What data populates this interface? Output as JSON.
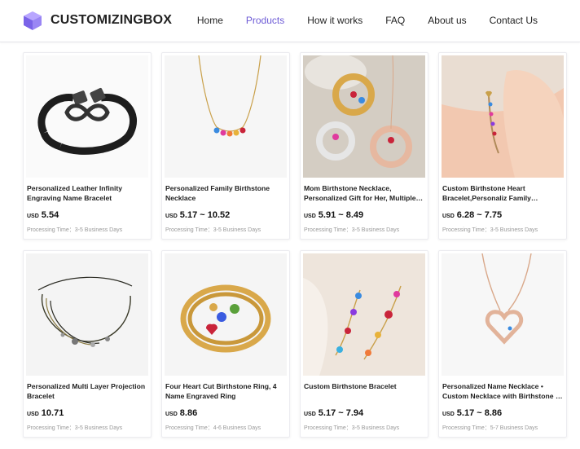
{
  "brand": {
    "name": "CUSTOMIZINGBOX",
    "logo_icon": "cube-logo-icon",
    "accent": "#6d5bd6"
  },
  "nav": [
    {
      "label": "Home",
      "active": false
    },
    {
      "label": "Products",
      "active": true
    },
    {
      "label": "How it works",
      "active": false
    },
    {
      "label": "FAQ",
      "active": false
    },
    {
      "label": "About us",
      "active": false
    },
    {
      "label": "Contact Us",
      "active": false
    }
  ],
  "products": [
    {
      "title": "Personalized Leather Infinity Engraving Name Bracelet",
      "currency": "USD",
      "price": "5.54",
      "processing": "Processing Time：3-5 Business Days",
      "image_icon": "leather-infinity-bracelet-image"
    },
    {
      "title": "Personalized Family Birthstone Necklace",
      "currency": "USD",
      "price": "5.17 ~ 10.52",
      "processing": "Processing Time：3-5 Business Days",
      "image_icon": "birthstone-necklace-image"
    },
    {
      "title": "Mom Birthstone Necklace, Personalized Gift for Her, Multiple Birthstone Necklace",
      "currency": "USD",
      "price": "5.91 ~ 8.49",
      "processing": "Processing Time：3-5 Business Days",
      "image_icon": "mom-circle-necklace-image"
    },
    {
      "title": "Custom Birthstone Heart Bracelet,Personaliz Family Birthstone Bracelet",
      "currency": "USD",
      "price": "6.28 ~ 7.75",
      "processing": "Processing Time：3-5 Business Days",
      "image_icon": "heart-bracelet-wrist-image"
    },
    {
      "title": "Personalized Multi Layer Projection Bracelet",
      "currency": "USD",
      "price": "10.71",
      "processing": "Processing Time：3-5 Business Days",
      "image_icon": "multi-layer-bracelet-image"
    },
    {
      "title": "Four Heart Cut Birthstone Ring, 4 Name Engraved Ring",
      "currency": "USD",
      "price": "8.86",
      "processing": "Processing Time：4-6 Business Days",
      "image_icon": "heart-birthstone-ring-image"
    },
    {
      "title": "Custom Birthstone Bracelet",
      "currency": "USD",
      "price": "5.17 ~ 7.94",
      "processing": "Processing Time：3-5 Business Days",
      "image_icon": "birthstone-chain-bracelet-image"
    },
    {
      "title": "Personalized Name Necklace • Custom Necklace with Birthstone • Birthstone Necklace",
      "currency": "USD",
      "price": "5.17 ~ 8.86",
      "processing": "Processing Time：5-7 Business Days",
      "image_icon": "heart-pendant-necklace-image"
    }
  ]
}
